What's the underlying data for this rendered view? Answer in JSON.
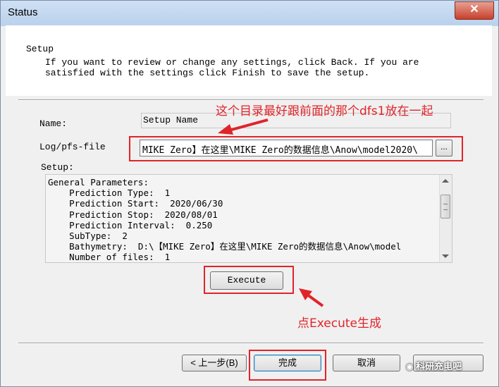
{
  "window": {
    "title": "Status",
    "close_symbol": "✕"
  },
  "header": {
    "heading": "Setup",
    "description": "If you want to review or change any settings, click Back. If you are\nsatisfied with the settings click Finish to save the setup."
  },
  "form": {
    "name_label": "Name:",
    "name_value": "Setup Name",
    "file_label": "Log/pfs-file",
    "file_value": "MIKE Zero】在这里\\MIKE Zero的数据信息\\Anow\\model2020\\",
    "browse_label": "...",
    "setup_label": "Setup:",
    "setup_lines": [
      "General Parameters:",
      "    Prediction Type:  1",
      "    Prediction Start:  2020/06/30",
      "    Prediction Stop:  2020/08/01",
      "    Prediction Interval:  0.250",
      "    SubType:  2",
      "    Bathymetry:  D:\\【MIKE Zero】在这里\\MIKE Zero的数据信息\\Anow\\model",
      "    Number of files:  1"
    ]
  },
  "buttons": {
    "execute": "Execute",
    "back": "< 上一步(B)",
    "finish": "完成",
    "cancel": "取消"
  },
  "annotations": {
    "directory_note": "这个目录最好跟前面的那个dfs1放在一起",
    "execute_note": "点Execute生成"
  },
  "watermark": "科研充电吧",
  "colors": {
    "annotation_red": "#e0242a",
    "titlebar": "#c5d9f0",
    "close": "#c7402b"
  }
}
